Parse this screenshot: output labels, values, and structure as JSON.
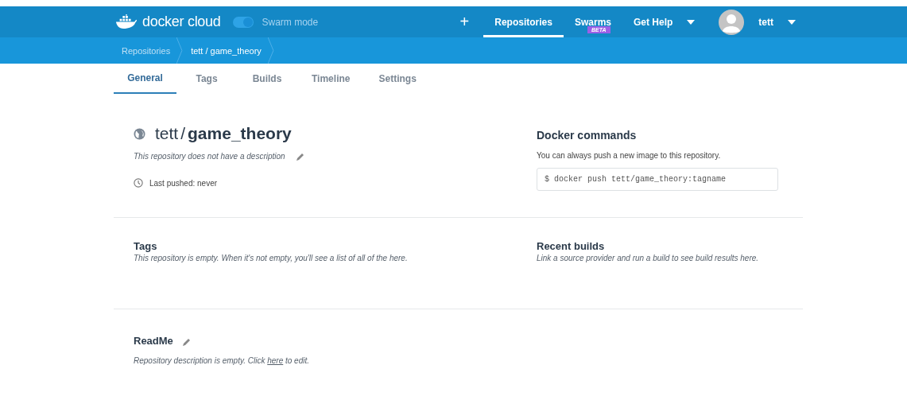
{
  "brand": "docker cloud",
  "swarm_mode": {
    "label": "Swarm mode",
    "on": true
  },
  "add_button": "+",
  "nav": [
    {
      "label": "Repositories",
      "selected": true
    },
    {
      "label": "Swarms",
      "selected": false,
      "badge": "BETA"
    },
    {
      "label": "Get Help",
      "selected": false,
      "dropdown": true
    }
  ],
  "user": {
    "name": "tett"
  },
  "breadcrumbs": [
    "Repositories",
    "tett / game_theory"
  ],
  "tabs": [
    {
      "label": "General",
      "selected": true
    },
    {
      "label": "Tags",
      "selected": false
    },
    {
      "label": "Builds",
      "selected": false
    },
    {
      "label": "Timeline",
      "selected": false
    },
    {
      "label": "Settings",
      "selected": false
    }
  ],
  "repo": {
    "owner": "tett",
    "separator": "/",
    "name": "game_theory",
    "description": "This repository does not have a description",
    "last_pushed": "Last pushed: never"
  },
  "docker_commands": {
    "title": "Docker commands",
    "text": "You can always push a new image to this repository.",
    "command": "$ docker push tett/game_theory:tagname"
  },
  "tags": {
    "title": "Tags",
    "text": "This repository is empty. When it's not empty, you'll see a list of all of the here."
  },
  "recent_builds": {
    "title": "Recent builds",
    "text": "Link a source provider and run a build to see build results here."
  },
  "readme": {
    "title": "ReadMe",
    "text_before": "Repository description is empty. Click",
    "link": "here",
    "text_after": "to edit."
  }
}
